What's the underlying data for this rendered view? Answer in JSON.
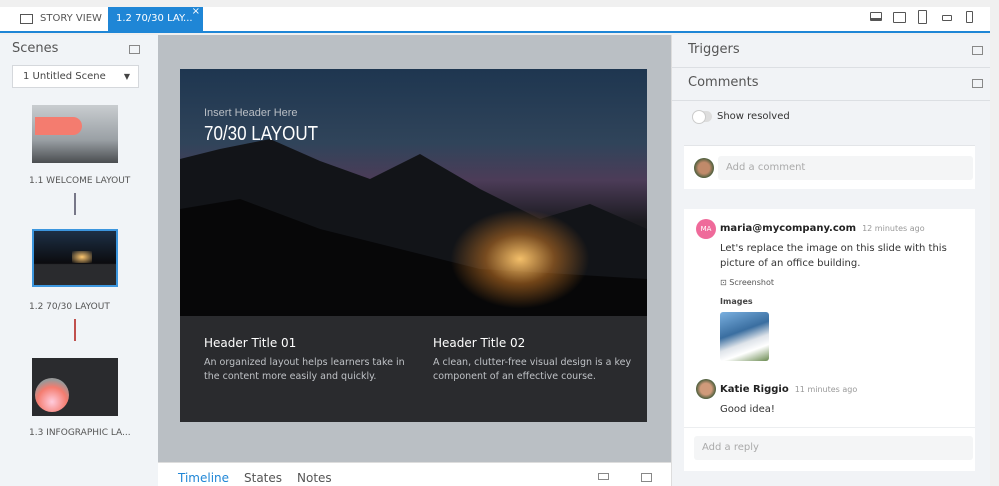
{
  "tabs": {
    "story_view": "STORY VIEW",
    "current": "1.2 70/30 LAY...",
    "close": "×"
  },
  "devices": [
    "laptop-icon",
    "tablet-landscape-icon",
    "tablet-portrait-icon",
    "phone-landscape-icon",
    "phone-portrait-icon"
  ],
  "scenes": {
    "title": "Scenes",
    "selected": "1 Untitled Scene",
    "slides": [
      {
        "label": "1.1 WELCOME LAYOUT"
      },
      {
        "label": "1.2 70/30 LAYOUT",
        "selected": true
      },
      {
        "label": "1.3  INFOGRAPHIC LA..."
      }
    ]
  },
  "slide": {
    "subtitle": "Insert Header Here",
    "title": "70/30 LAYOUT",
    "col1": {
      "heading": "Header Title 01",
      "body": "An organized layout helps learners take in the content more easily and quickly."
    },
    "col2": {
      "heading": "Header Title 02",
      "body": "A clean, clutter-free visual design is a key component of an effective course."
    }
  },
  "bottom_tabs": [
    "Timeline",
    "States",
    "Notes"
  ],
  "right": {
    "triggers": "Triggers",
    "comments": "Comments",
    "show_resolved": "Show resolved",
    "add_comment": "Add a comment",
    "thread": {
      "author": "maria@mycompany.com",
      "initials": "MA",
      "time": "12 minutes ago",
      "text": "Let's replace the image on this slide with this picture of an office building.",
      "screenshot": "Screenshot",
      "images_label": "Images",
      "reply": {
        "author": "Katie Riggio",
        "time": "11 minutes ago",
        "text": "Good idea!"
      },
      "reply_placeholder": "Add a reply"
    }
  },
  "colors": {
    "accent": "#1f86d6",
    "avatar_pink": "#ef6a9a",
    "arrow_red": "#c0504d"
  }
}
